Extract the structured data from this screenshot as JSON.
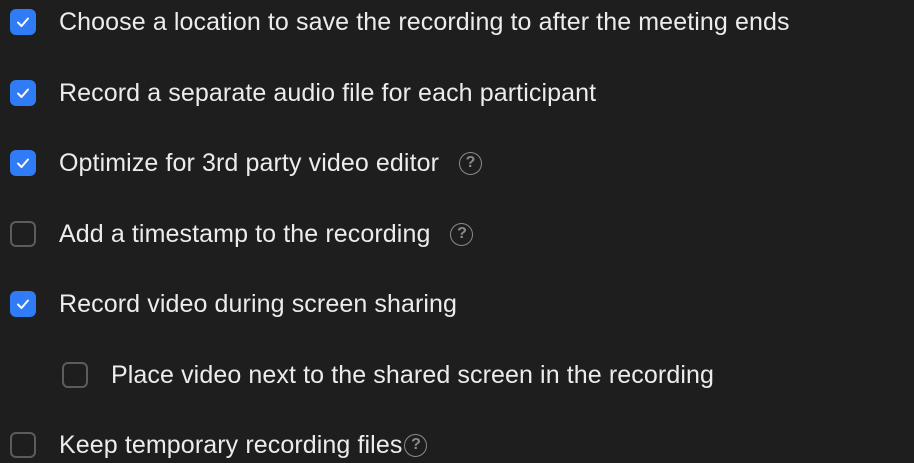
{
  "settings": [
    {
      "label": "Choose a location to save the recording to after the meeting ends",
      "checked": true,
      "help": false
    },
    {
      "label": "Record a separate audio file for each participant",
      "checked": true,
      "help": false
    },
    {
      "label": "Optimize for 3rd party video editor",
      "checked": true,
      "help": true
    },
    {
      "label": "Add a timestamp to the recording",
      "checked": false,
      "help": true
    },
    {
      "label": "Record video during screen sharing",
      "checked": true,
      "help": false
    },
    {
      "label": "Place video next to the shared screen in the recording",
      "checked": false,
      "help": false
    },
    {
      "label": "Keep temporary recording files",
      "checked": false,
      "help": true
    }
  ],
  "help_glyph": "?",
  "icons": {
    "check": "checkmark-icon",
    "help": "question-circle-icon"
  },
  "colors": {
    "accent": "#2f7cf6",
    "background": "#1e1e1e"
  }
}
